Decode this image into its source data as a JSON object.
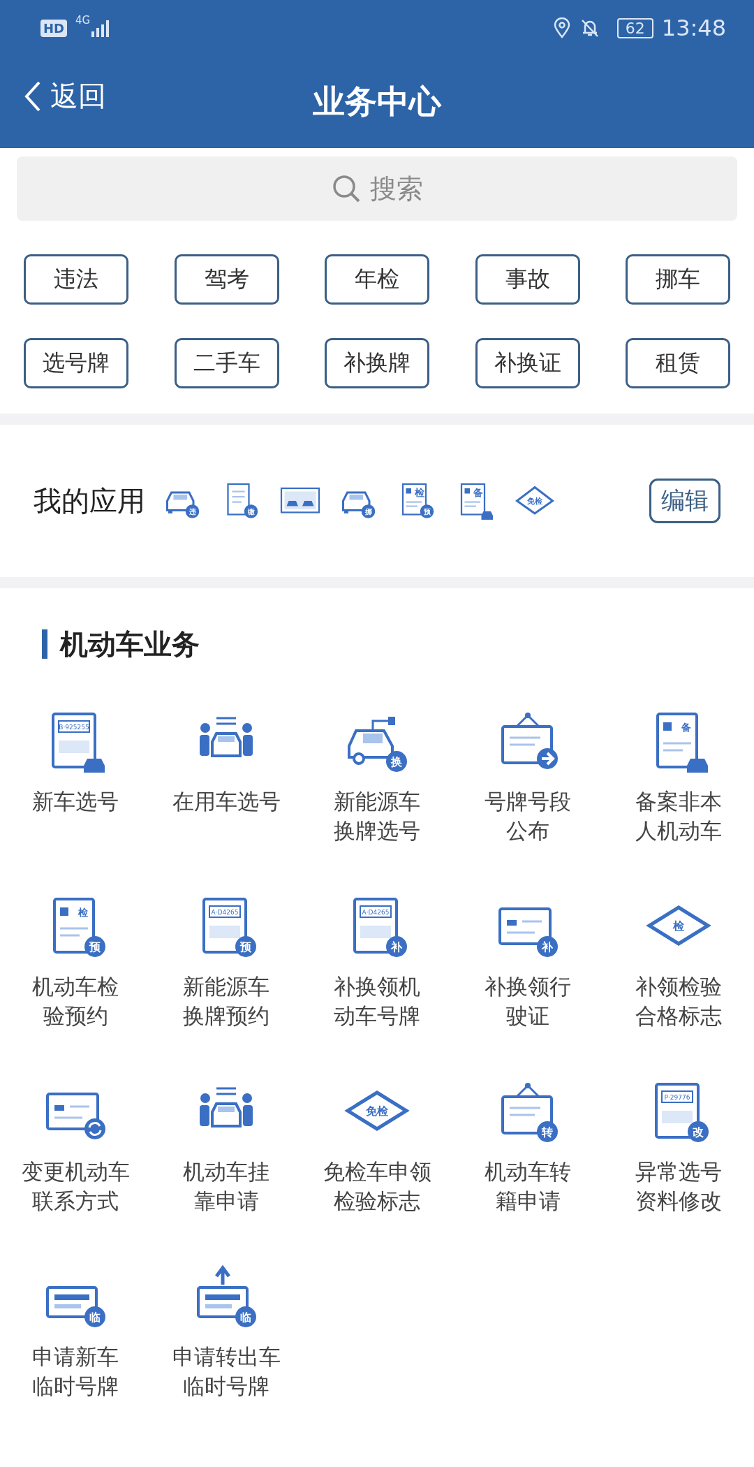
{
  "status_bar": {
    "hd": "HD",
    "network": "4G",
    "battery": "62",
    "time": "13:48"
  },
  "header": {
    "back": "返回",
    "title": "业务中心"
  },
  "search": {
    "placeholder": "搜索"
  },
  "chips": [
    "违法",
    "驾考",
    "年检",
    "事故",
    "挪车",
    "选号牌",
    "二手车",
    "补换牌",
    "补换证",
    "租赁"
  ],
  "my_apps": {
    "title": "我的应用",
    "edit": "编辑",
    "apps": [
      {
        "kind": "car",
        "badge": "违"
      },
      {
        "kind": "scroll",
        "badge": "缴"
      },
      {
        "kind": "crash"
      },
      {
        "kind": "car",
        "badge": "挪"
      },
      {
        "kind": "doc",
        "label": "检",
        "badge": "预"
      },
      {
        "kind": "doc",
        "label": "备",
        "car": true
      },
      {
        "kind": "diamond",
        "label": "免检"
      }
    ]
  },
  "section": {
    "title": "机动车业务",
    "items": [
      {
        "name": [
          "新车选号"
        ],
        "kind": "plate",
        "label": "B·925255",
        "car": true
      },
      {
        "name": [
          "在用车选号"
        ],
        "kind": "people"
      },
      {
        "name": [
          "新能源车",
          "换牌选号"
        ],
        "kind": "ev",
        "badge": "换"
      },
      {
        "name": [
          "号牌号段",
          "公布"
        ],
        "kind": "sign",
        "arrow_badge": true
      },
      {
        "name": [
          "备案非本",
          "人机动车"
        ],
        "kind": "doc",
        "label": "备",
        "car": true
      },
      {
        "name": [
          "机动车检",
          "验预约"
        ],
        "kind": "doc",
        "label": "检",
        "badge": "预"
      },
      {
        "name": [
          "新能源车",
          "换牌预约"
        ],
        "kind": "plate",
        "label": "A·D4265",
        "badge": "预"
      },
      {
        "name": [
          "补换领机",
          "动车号牌"
        ],
        "kind": "plate",
        "label": "A·D4265",
        "badge": "补"
      },
      {
        "name": [
          "补换领行",
          "驶证"
        ],
        "kind": "card",
        "badge": "补"
      },
      {
        "name": [
          "补领检验",
          "合格标志"
        ],
        "kind": "diamond",
        "label": "检"
      },
      {
        "name": [
          "变更机动车",
          "联系方式"
        ],
        "kind": "card",
        "refresh_badge": true
      },
      {
        "name": [
          "机动车挂",
          "靠申请"
        ],
        "kind": "people"
      },
      {
        "name": [
          "免检车申领",
          "检验标志"
        ],
        "kind": "diamond",
        "label": "免检"
      },
      {
        "name": [
          "机动车转",
          "籍申请"
        ],
        "kind": "sign",
        "badge": "转"
      },
      {
        "name": [
          "异常选号",
          "资料修改"
        ],
        "kind": "plate",
        "label": "P·29776",
        "badge": "改"
      },
      {
        "name": [
          "申请新车",
          "临时号牌"
        ],
        "kind": "temp",
        "badge": "临"
      },
      {
        "name": [
          "申请转出车",
          "临时号牌"
        ],
        "kind": "temp",
        "badge": "临",
        "up_arrow": true
      }
    ]
  }
}
